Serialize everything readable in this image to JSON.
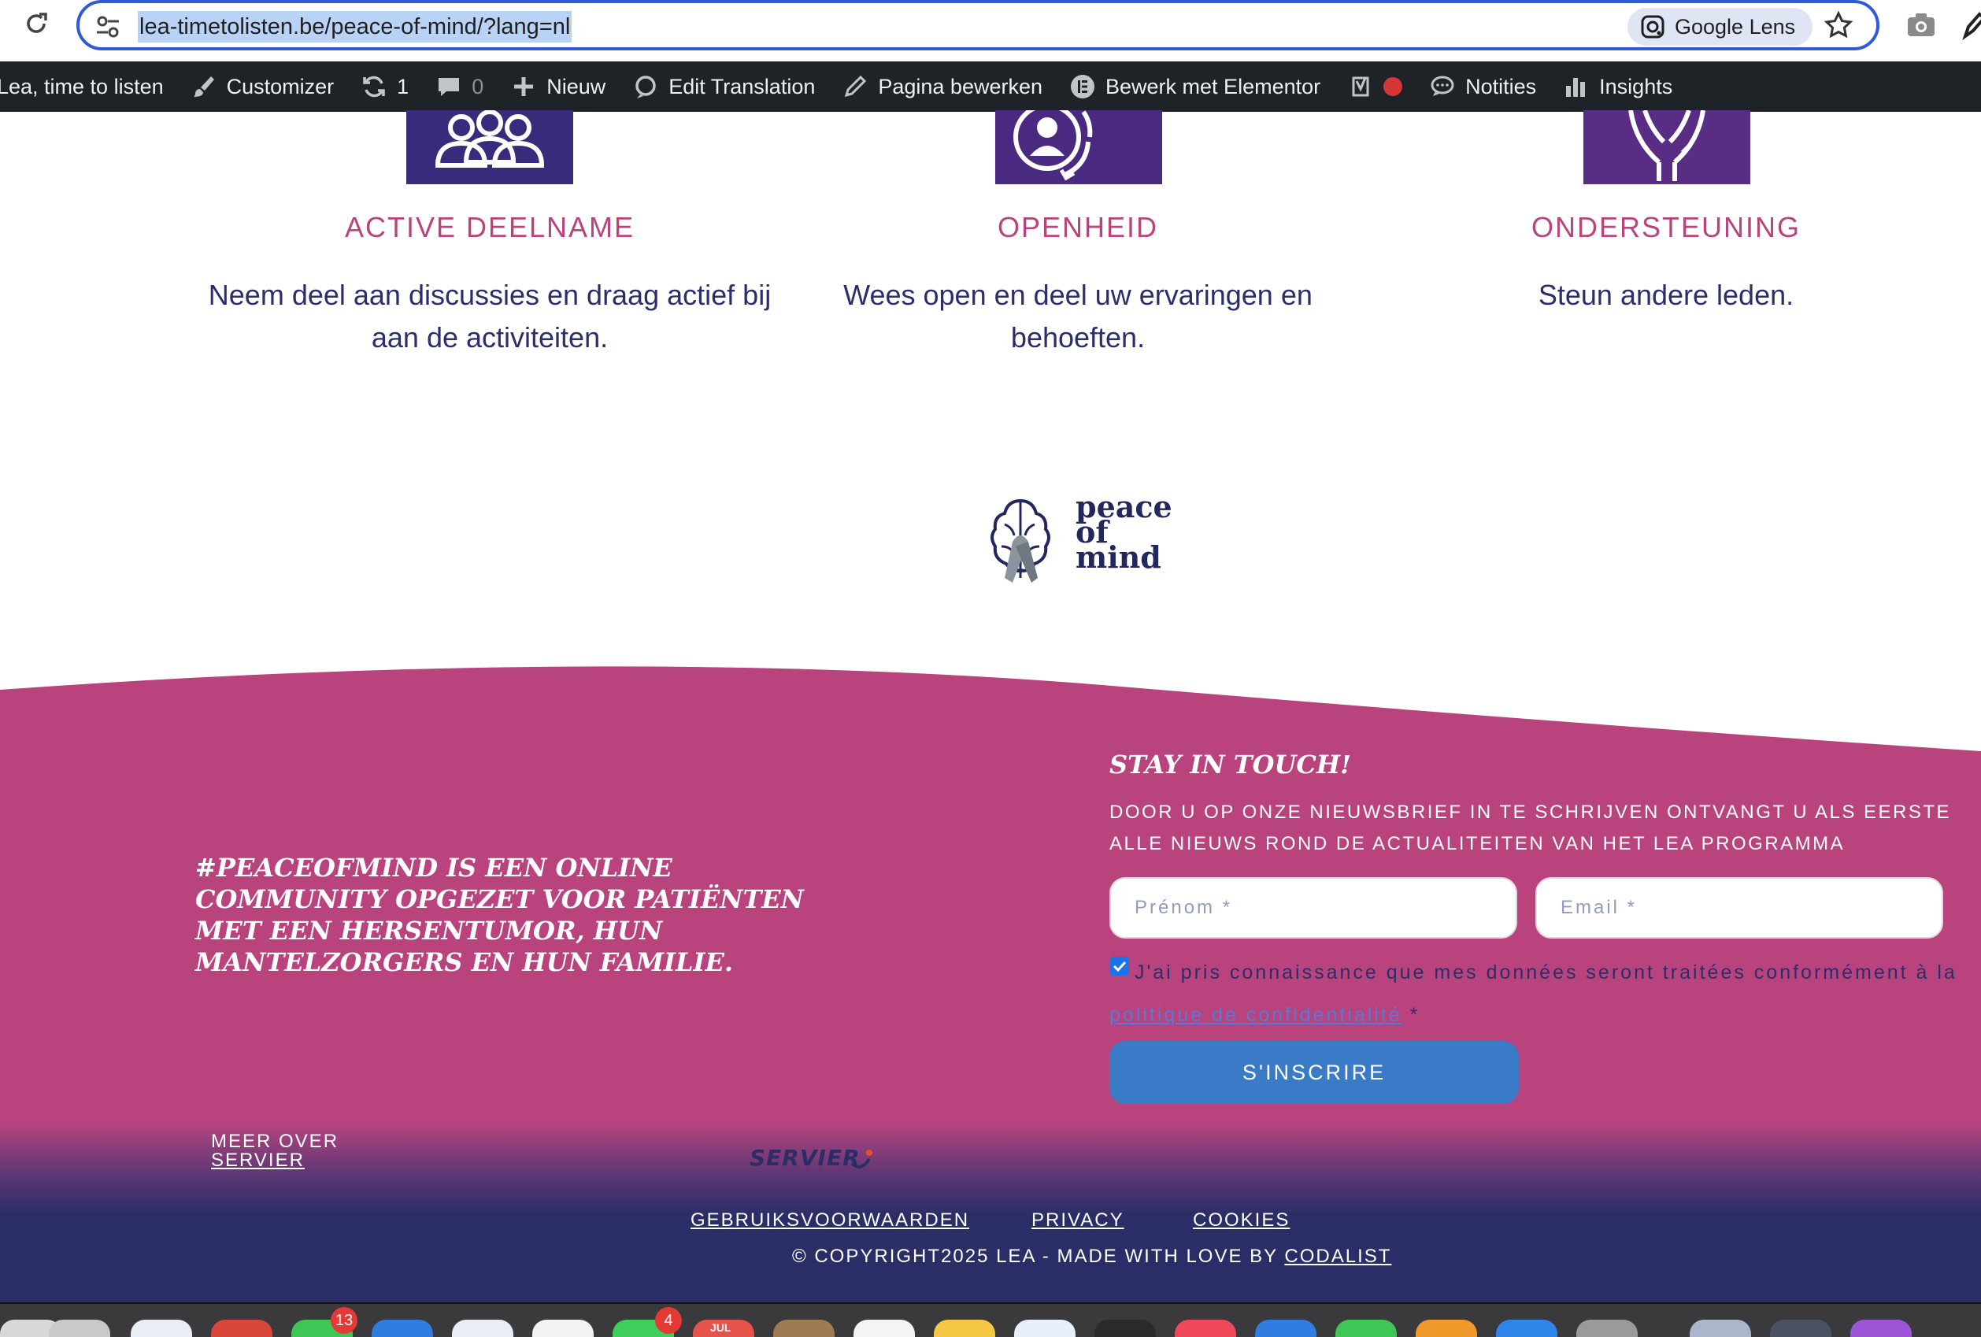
{
  "browser": {
    "url": "lea-timetolisten.be/peace-of-mind/?lang=nl",
    "lens_label": "Google Lens"
  },
  "adminbar": {
    "site": "Lea, time to listen",
    "customizer": "Customizer",
    "updates_count": "1",
    "comments_count": "0",
    "new": "Nieuw",
    "edit_translation": "Edit Translation",
    "edit_page": "Pagina bewerken",
    "elementor": "Bewerk met Elementor",
    "notes": "Notities",
    "insights": "Insights"
  },
  "features": [
    {
      "title": "ACTIVE DEELNAME",
      "text": "Neem deel aan discussies en draag actief bij aan de activiteiten.",
      "icon": "group-icon",
      "color": "#3a2a7c"
    },
    {
      "title": "OPENHEID",
      "text": "Wees open en deel uw ervaringen en behoeften.",
      "icon": "person-cycle-icon",
      "color": "#4a2a80"
    },
    {
      "title": "ONDERSTEUNING",
      "text": "Steun andere leden.",
      "icon": "supporting-hands-icon",
      "color": "#5a2d85"
    }
  ],
  "logo": {
    "line1": "peace",
    "line2": "of",
    "line3": "mind"
  },
  "footer": {
    "tagline": "#PEACEOFMIND IS EEN ONLINE COMMUNITY OPGEZET VOOR PATIËNTEN MET EEN HERSENTUMOR, HUN MANTELZORGERS EN HUN FAMILIE.",
    "stay_title": "STAY IN TOUCH!",
    "stay_desc": "DOOR U OP ONZE NIEUWSBRIEF IN TE SCHRIJVEN ONTVANGT U ALS EERSTE ALLE NIEUWS ROND DE ACTUALITEITEN VAN HET LEA PROGRAMMA",
    "firstname_placeholder": "Prénom *",
    "email_placeholder": "Email *",
    "consent_text": "J'ai pris connaissance que mes données seront traitées conformément à la",
    "consent_link": "politique de confidentialité",
    "consent_required": " *",
    "consent_checked": true,
    "submit_label": "S'INSCRIRE",
    "meer_over": "MEER OVER",
    "servier_link": "SERVIER",
    "servier_logo": "SERVIER",
    "links": [
      "GEBRUIKSVOORWAARDEN",
      "PRIVACY",
      "COOKIES"
    ],
    "copyright": "© COPYRIGHT2025 LEA - MADE WITH LOVE BY ",
    "codalist": "CODALIST",
    "colors": {
      "pink": "#b9437d",
      "navy": "#2b2d66",
      "button": "#3a7bc8"
    }
  },
  "dock": {
    "messages_badge": "13",
    "facetime_badge": "4",
    "calendar_month": "JUL"
  }
}
